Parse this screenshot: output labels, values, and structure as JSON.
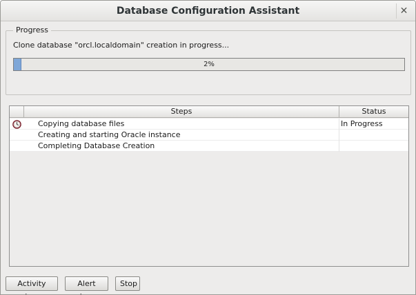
{
  "window": {
    "title": "Database Configuration Assistant"
  },
  "progress": {
    "legend": "Progress",
    "message": "Clone database \"orcl.localdomain\" creation in progress...",
    "percent": 2,
    "percent_label": "2%",
    "fill_color": "#7fa7d8"
  },
  "steps_table": {
    "headers": {
      "steps": "Steps",
      "status": "Status"
    },
    "rows": [
      {
        "step": "Copying database files",
        "status": "In Progress",
        "icon": "clock-icon"
      },
      {
        "step": "Creating and starting Oracle instance",
        "status": "",
        "icon": ""
      },
      {
        "step": "Completing Database Creation",
        "status": "",
        "icon": ""
      }
    ]
  },
  "buttons": {
    "activity_log": "Activity Log",
    "alert_log": "Alert Log",
    "stop": "Stop"
  }
}
